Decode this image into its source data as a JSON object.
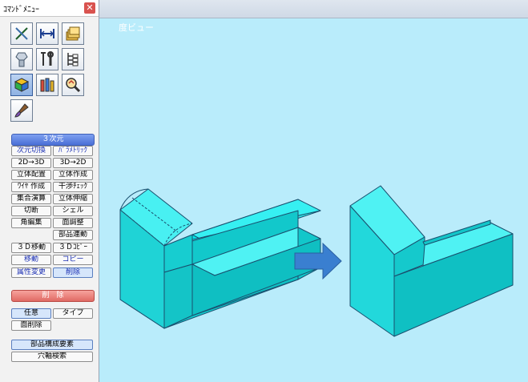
{
  "panel": {
    "title": "ｺﾏﾝﾄﾞﾒﾆｭｰ",
    "close_glyph": "✕"
  },
  "viewport": {
    "title": "度ビュー"
  },
  "sections": {
    "three_d": "３次元",
    "delete": "削　除"
  },
  "commands": {
    "dim_switch": "次元切換",
    "parametric": "ﾊﾟﾗﾒﾄﾘｯｸ",
    "to3d": "2D→3D",
    "to2d": "3D→2D",
    "solid_place": "立体配置",
    "solid_create": "立体作成",
    "wire_create": "ﾜｲﾔ 作成",
    "interference": "干渉ﾁｪｯｸ",
    "boolean": "集合演算",
    "stretch": "立体伸縮",
    "cut": "切断",
    "shell": "シェル",
    "edge_edit": "角編集",
    "face_adjust": "面調整",
    "part_link": "部品連動",
    "move3d": "３Ｄ移動",
    "copy3d": "３Ｄｺﾋﾟｰ",
    "move": "移動",
    "copy": "コピー",
    "attr_change": "属性変更",
    "delete_cmd": "削除",
    "any": "任意",
    "type": "タイプ",
    "face_delete": "面削除",
    "part_elements": "部品構成要素",
    "hole_search": "穴軸検索"
  },
  "icons": [
    "draw-line-icon",
    "dimension-icon",
    "layer-folder-icon",
    "part-bolt-icon",
    "tools-icon",
    "tree-structure-icon",
    "3d-solid-icon",
    "parts-library-icon",
    "analysis-icon",
    "paint-brush-icon"
  ],
  "colors": {
    "solid_fill": "#22d6d8",
    "solid_edge": "#1a4f6e",
    "arrow": "#3a7fd0",
    "viewport_bg": "#b9ecfb"
  }
}
